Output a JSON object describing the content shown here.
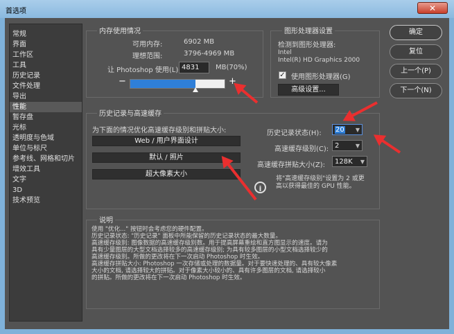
{
  "window": {
    "title": "首选项",
    "close_glyph": "✕"
  },
  "sidebar": {
    "items": [
      "常规",
      "界面",
      "工作区",
      "工具",
      "历史记录",
      "文件处理",
      "导出",
      "性能",
      "暂存盘",
      "光标",
      "透明度与色域",
      "单位与标尺",
      "参考线、网格和切片",
      "增效工具",
      "文字",
      "3D",
      "技术预览"
    ],
    "selected": "性能"
  },
  "memory": {
    "title": "内存使用情况",
    "available_label": "可用内存:",
    "available_value": "6902 MB",
    "ideal_label": "理想范围:",
    "ideal_value": "3796-4969 MB",
    "usage_label": "让 Photoshop 使用(L):",
    "usage_value": "4831",
    "usage_suffix": "MB(70%)",
    "usage_fraction": 0.7,
    "minus": "−",
    "plus": "+"
  },
  "gpu": {
    "title": "图形处理器设置",
    "detected_label": "检测到图形处理器:",
    "vendor": "Intel",
    "model": "Intel(R) HD Graphics 2000",
    "use_gpu_label": "使用图形处理器(G)",
    "use_gpu_checked": true,
    "advanced_button": "高级设置..."
  },
  "history": {
    "title": "历史记录与高速缓存",
    "optimize_label": "为下面的情况优化高速缓存级别和拼贴大小:",
    "presets": [
      "Web / 用户界面设计",
      "默认 / 照片",
      "超大像素大小"
    ],
    "states_label": "历史记录状态(H):",
    "states_value": "20",
    "cache_levels_label": "高速缓存级别(C):",
    "cache_levels_value": "2",
    "tile_size_label": "高速缓存拼贴大小(Z):",
    "tile_size_value": "128K",
    "info_text_1": "将\"高速缓存级别\"设置为 2 或更",
    "info_text_2": "高以获得最佳的 GPU 性能。"
  },
  "description": {
    "title": "说明",
    "lines": [
      "使用 \"优化...\" 按钮时会考虑您的硬件配置。",
      "历史记录状态: \"历史记录\" 面板中所能保留的历史记录状态的最大数量。",
      "高速缓存级别: 图像数据的高速缓存级别数。用于提高屏幕重绘和直方图显示的速度。请为",
      "具有少量图层的大型文档选择较多的高速缓存级别; 为具有较多图层的小型文档选择较少的",
      "高速缓存级别。所做的更改将在下一次启动 Photoshop 时生效。",
      "高速缓存拼贴大小: Photoshop 一次存储或处理的数据量。对于要快速处理的、具有较大像素",
      "大小的文档, 请选择较大的拼贴。对于像素大小较小的、具有许多图层的文档, 请选择较小",
      "的拼贴。所做的更改将在下一次启动 Photoshop 时生效。"
    ]
  },
  "buttons": {
    "ok": "确定",
    "reset": "复位",
    "prev": "上一个(P)",
    "next": "下一个(N)"
  },
  "colors": {
    "accent": "#2f7fd8",
    "annotation": "#ea2f2f",
    "panel": "#535353"
  }
}
